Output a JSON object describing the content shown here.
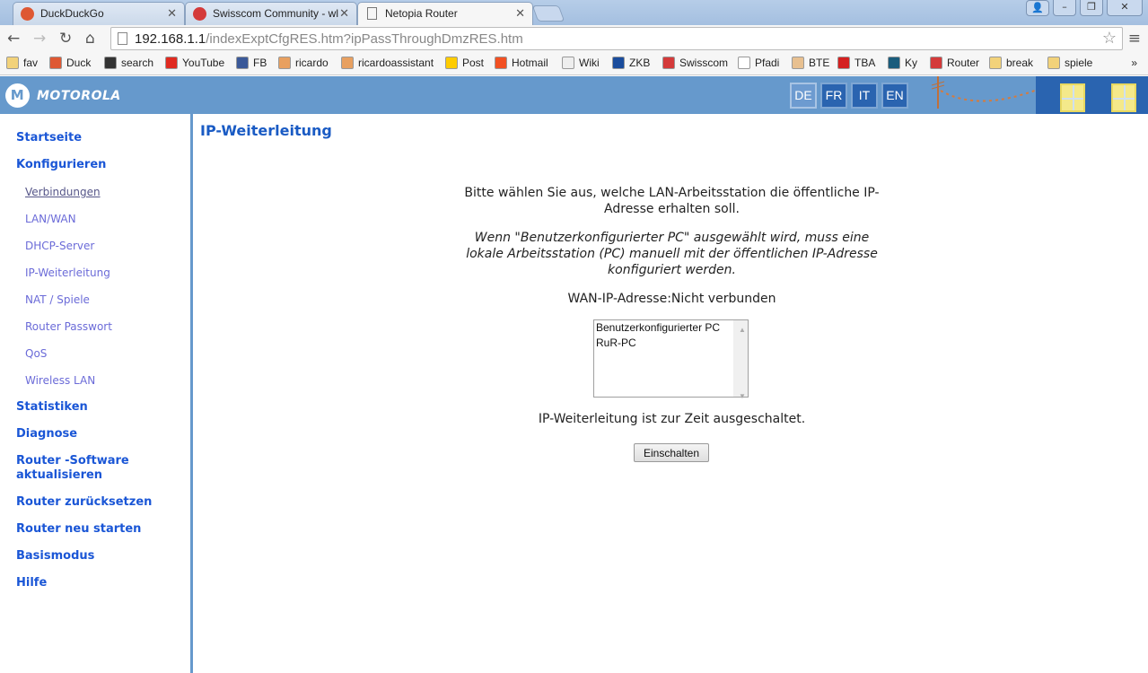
{
  "browser": {
    "tabs": [
      {
        "label": "DuckDuckGo",
        "icon": "duckduckgo-icon",
        "color": "#de5833"
      },
      {
        "label": "Swisscom Community - wl",
        "icon": "swisscom-icon",
        "color": "#d43a3a"
      },
      {
        "label": "Netopia Router",
        "icon": "page-icon",
        "color": "#ffffff"
      }
    ],
    "url_host": "192.168.1.1",
    "url_path": "/indexExptCfgRES.htm?ipPassThroughDmzRES.htm",
    "bookmarks": [
      {
        "label": "fav",
        "icon": "folder-icon",
        "color": "#f2d27a"
      },
      {
        "label": "Duck",
        "icon": "duckduckgo-icon",
        "color": "#de5833"
      },
      {
        "label": "search",
        "icon": "s-icon",
        "color": "#333333"
      },
      {
        "label": "YouTube",
        "icon": "youtube-icon",
        "color": "#e02a20"
      },
      {
        "label": "FB",
        "icon": "facebook-icon",
        "color": "#3b5998"
      },
      {
        "label": "ricardo",
        "icon": "hand-icon",
        "color": "#e8a060"
      },
      {
        "label": "ricardoassistant",
        "icon": "hand-icon",
        "color": "#e8a060"
      },
      {
        "label": "Post",
        "icon": "post-icon",
        "color": "#ffcc00"
      },
      {
        "label": "Hotmail",
        "icon": "windows-icon",
        "color": "#f25022"
      },
      {
        "label": "Wiki",
        "icon": "wikipedia-icon",
        "color": "#eeeeee"
      },
      {
        "label": "ZKB",
        "icon": "zkb-icon",
        "color": "#1a4c9c"
      },
      {
        "label": "Swisscom",
        "icon": "swisscom-icon",
        "color": "#d43a3a"
      },
      {
        "label": "Pfadi",
        "icon": "page-icon",
        "color": "#ffffff"
      },
      {
        "label": "BTE",
        "icon": "ball-icon",
        "color": "#e8c090"
      },
      {
        "label": "TBA",
        "icon": "tba-icon",
        "color": "#d42020"
      },
      {
        "label": "Ky",
        "icon": "shield-icon",
        "color": "#1a5c7c"
      },
      {
        "label": "Router",
        "icon": "swisscom-icon",
        "color": "#d43a3a"
      },
      {
        "label": "break",
        "icon": "folder-icon",
        "color": "#f2d27a"
      },
      {
        "label": "spiele",
        "icon": "folder-icon",
        "color": "#f2d27a"
      }
    ],
    "overflow": "»"
  },
  "header": {
    "brand": "MOTOROLA",
    "languages": [
      "DE",
      "FR",
      "IT",
      "EN"
    ],
    "selected_language": "DE"
  },
  "sidebar": {
    "items": [
      {
        "label": "Startseite",
        "type": "main"
      },
      {
        "label": "Konfigurieren",
        "type": "main"
      },
      {
        "label": "Verbindungen",
        "type": "sub",
        "visited": true
      },
      {
        "label": "LAN/WAN",
        "type": "sub"
      },
      {
        "label": "DHCP-Server",
        "type": "sub"
      },
      {
        "label": "IP-Weiterleitung",
        "type": "sub"
      },
      {
        "label": "NAT / Spiele",
        "type": "sub"
      },
      {
        "label": "Router Passwort",
        "type": "sub"
      },
      {
        "label": "QoS",
        "type": "sub"
      },
      {
        "label": "Wireless LAN",
        "type": "sub"
      },
      {
        "label": "Statistiken",
        "type": "main"
      },
      {
        "label": "Diagnose",
        "type": "main"
      },
      {
        "label": "Router -Software aktualisieren",
        "type": "main"
      },
      {
        "label": "Router zurücksetzen",
        "type": "main"
      },
      {
        "label": "Router neu starten",
        "type": "main"
      },
      {
        "label": "Basismodus",
        "type": "main"
      },
      {
        "label": "Hilfe",
        "type": "main"
      }
    ]
  },
  "main": {
    "title": "IP-Weiterleitung",
    "intro_line1": "Bitte wählen Sie aus, welche LAN-Arbeitsstation die öffentliche IP-",
    "intro_line2": "Adresse erhalten soll.",
    "note_line1": "Wenn \"Benutzerkonfigurierter PC\" ausgewählt wird, muss eine",
    "note_line2": "lokale Arbeitsstation (PC) manuell mit der öffentlichen IP-Adresse",
    "note_line3": "konfiguriert werden.",
    "wan_label": "WAN-IP-Adresse:",
    "wan_value": "Nicht verbunden",
    "stations": [
      "Benutzerkonfigurierter PC",
      "RuR-PC"
    ],
    "status": "IP-Weiterleitung ist zur Zeit ausgeschaltet.",
    "enable_button": "Einschalten"
  }
}
